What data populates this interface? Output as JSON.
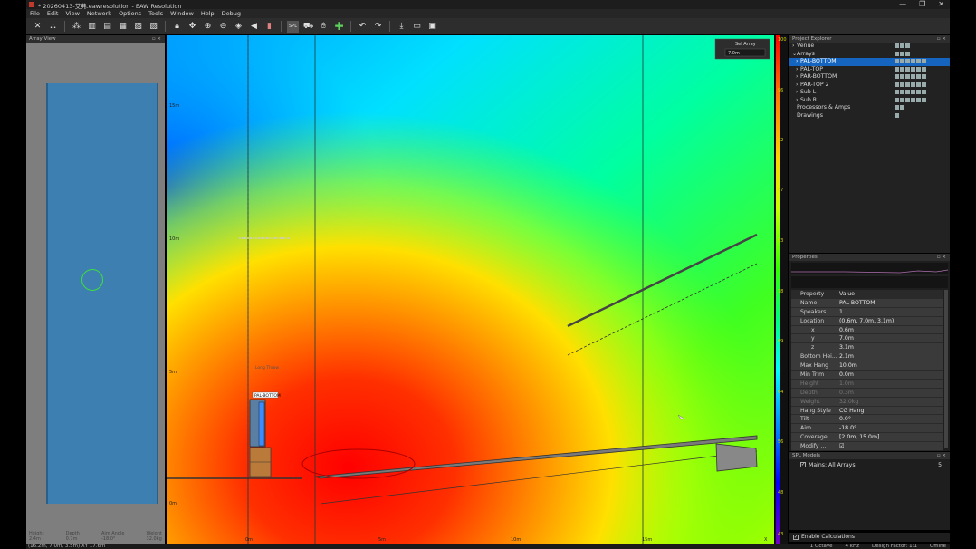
{
  "window": {
    "title": "* 20260413-艾弗.eawresolution - EAW Resolution",
    "minimize": "—",
    "maximize": "❐",
    "close": "✕"
  },
  "menu": [
    "File",
    "Edit",
    "View",
    "Network",
    "Options",
    "Tools",
    "Window",
    "Help",
    "Debug"
  ],
  "toolbar": {
    "icons": [
      "cross-tools-icon",
      "speaker-cluster-icon",
      "array-icon",
      "bar-chart-icon",
      "bar-chart-2-icon",
      "bar-chart-3-icon",
      "bar-chart-4-icon",
      "bar-chart-5-icon",
      "lock-icon",
      "move-icon",
      "zoom-in-icon",
      "zoom-out-icon",
      "pin-icon",
      "speaker-icon",
      "microphone-icon",
      "spl-icon",
      "camera-icon",
      "hand-icon",
      "add-icon",
      "undo-icon",
      "redo-icon",
      "import-icon",
      "open-icon",
      "save-icon"
    ],
    "spl_label": "SPL"
  },
  "array_view": {
    "title": "Array View",
    "footer": [
      {
        "label": "Height",
        "value": "2.4m"
      },
      {
        "label": "Depth",
        "value": "0.7m"
      },
      {
        "label": "Aim Angle",
        "value": "-18.0°"
      },
      {
        "label": "Weight",
        "value": "32.0kg"
      }
    ]
  },
  "plot": {
    "sel_array_label": "Sel Array",
    "sel_array_value": "7.0m",
    "y_labels": [
      "15m",
      "10m",
      "5m",
      "0m"
    ],
    "x_labels": [
      "0m",
      "5m",
      "10m",
      "15m"
    ],
    "x_axis_label": "X",
    "speaker_tag": "PAL-BOTTOM",
    "callout_text": "Long Throw"
  },
  "colorbar": {
    "ticks": [
      "100",
      "96",
      "92",
      "87",
      "83",
      "78",
      "69",
      "64",
      "56",
      "48",
      "43"
    ]
  },
  "project_explorer": {
    "title": "Project Explorer",
    "rows": [
      {
        "label": "Venue",
        "indent": 0,
        "arrow": "›",
        "selected": false
      },
      {
        "label": "Arrays",
        "indent": 0,
        "arrow": "⌄",
        "selected": false
      },
      {
        "label": "PAL-BOTTOM",
        "indent": 1,
        "arrow": "›",
        "selected": true
      },
      {
        "label": "PAL-TOP",
        "indent": 1,
        "arrow": "›",
        "selected": false
      },
      {
        "label": "PAR-BOTTOM",
        "indent": 1,
        "arrow": "›",
        "selected": false
      },
      {
        "label": "PAR-TOP 2",
        "indent": 1,
        "arrow": "›",
        "selected": false
      },
      {
        "label": "Sub L",
        "indent": 1,
        "arrow": "›",
        "selected": false
      },
      {
        "label": "Sub R",
        "indent": 1,
        "arrow": "›",
        "selected": false
      },
      {
        "label": "Processors & Amps",
        "indent": 0,
        "arrow": "",
        "selected": false
      },
      {
        "label": "Drawings",
        "indent": 0,
        "arrow": "",
        "selected": false
      }
    ]
  },
  "properties": {
    "title": "Properties",
    "header": {
      "k": "Property",
      "v": "Value"
    },
    "rows": [
      {
        "k": "Name",
        "v": "PAL-BOTTOM",
        "dim": false
      },
      {
        "k": "Speakers",
        "v": "1",
        "dim": false
      },
      {
        "k": "Location",
        "v": "(0.6m, 7.0m, 3.1m)",
        "dim": false
      },
      {
        "k": "x",
        "v": "0.6m",
        "dim": false
      },
      {
        "k": "y",
        "v": "7.0m",
        "dim": false
      },
      {
        "k": "z",
        "v": "3.1m",
        "dim": false
      },
      {
        "k": "Bottom Hei...",
        "v": "2.1m",
        "dim": false
      },
      {
        "k": "Max Hang",
        "v": "10.0m",
        "dim": false
      },
      {
        "k": "Min Trim",
        "v": "0.0m",
        "dim": false
      },
      {
        "k": "Height",
        "v": "1.0m",
        "dim": true
      },
      {
        "k": "Depth",
        "v": "0.3m",
        "dim": true
      },
      {
        "k": "Weight",
        "v": "32.0kg",
        "dim": true
      },
      {
        "k": "Hang Style",
        "v": "CG Hang",
        "dim": false
      },
      {
        "k": "Tilt",
        "v": "0.0°",
        "dim": false
      },
      {
        "k": "Aim",
        "v": "-18.0°",
        "dim": false
      },
      {
        "k": "Coverage",
        "v": "[2.0m, 15.0m]",
        "dim": false
      },
      {
        "k": "Modify ...",
        "v": "☑",
        "dim": false
      }
    ]
  },
  "spl_models": {
    "title": "SPL Models",
    "item": "Mains: All Arrays",
    "count": "5"
  },
  "enable_calc": "Enable Calculations",
  "statusbar": {
    "left": "(16.2m, 7.0m, 3.5m) XY 17.6m",
    "right": [
      "1 Octave",
      "4 kHz",
      "Design Factor: 1:1",
      "Offline"
    ]
  }
}
